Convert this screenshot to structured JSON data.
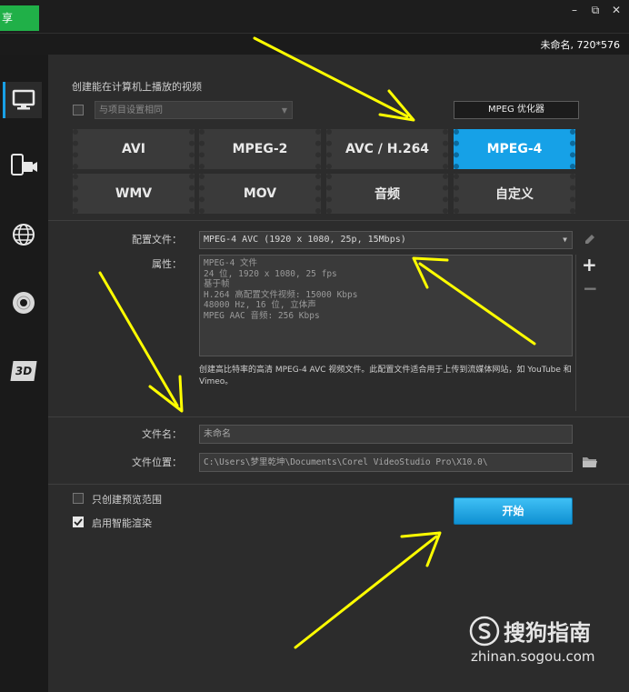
{
  "window": {
    "tab_label": "享",
    "minimize": "–",
    "restore": "⧉",
    "close": "✕",
    "project_info": "未命名, 720*576"
  },
  "sidebar": {
    "items": [
      {
        "icon": "computer-icon",
        "active": true
      },
      {
        "icon": "mobile-device-icon",
        "active": false
      },
      {
        "icon": "globe-icon",
        "active": false
      },
      {
        "icon": "disc-icon",
        "active": false
      },
      {
        "icon": "3d-icon",
        "label": "3D",
        "active": false
      }
    ]
  },
  "format_section": {
    "title": "创建能在计算机上播放的视频",
    "same_as_project_label": "与项目设置相同",
    "optimizer_button": "MPEG 优化器",
    "formats": [
      "AVI",
      "MPEG-2",
      "AVC / H.264",
      "MPEG-4",
      "WMV",
      "MOV",
      "音频",
      "自定义"
    ],
    "selected_format": "MPEG-4"
  },
  "profile_section": {
    "profile_label": "配置文件：",
    "profile_value": "MPEG-4 AVC (1920 x 1080, 25p, 15Mbps)",
    "properties_label": "属性：",
    "properties_lines": [
      "MPEG-4 文件",
      "24 位, 1920 x 1080, 25 fps",
      "基于帧",
      "H.264 高配置文件视频: 15000 Kbps",
      "48000 Hz, 16 位, 立体声",
      "MPEG AAC 音频: 256 Kbps"
    ],
    "description": "创建高比特率的高清 MPEG-4 AVC 视频文件。此配置文件适合用于上传到流媒体网站，如 YouTube 和 Vimeo。",
    "edit_icon": "pencil-icon",
    "add_label": "+",
    "remove_label": "−"
  },
  "file_section": {
    "filename_label": "文件名：",
    "filename_value": "未命名",
    "location_label": "文件位置：",
    "location_value": "C:\\Users\\梦里乾坤\\Documents\\Corel VideoStudio Pro\\X10.0\\"
  },
  "options": {
    "preview_range_label": "只创建预览范围",
    "preview_range_checked": false,
    "smart_render_label": "启用智能渲染",
    "smart_render_checked": true,
    "start_button": "开始"
  },
  "watermark": {
    "brand": "搜狗指南",
    "url": "zhinan.sogou.com"
  },
  "colors": {
    "accent": "#16a1e7",
    "annotation_arrow": "#ffff00"
  }
}
